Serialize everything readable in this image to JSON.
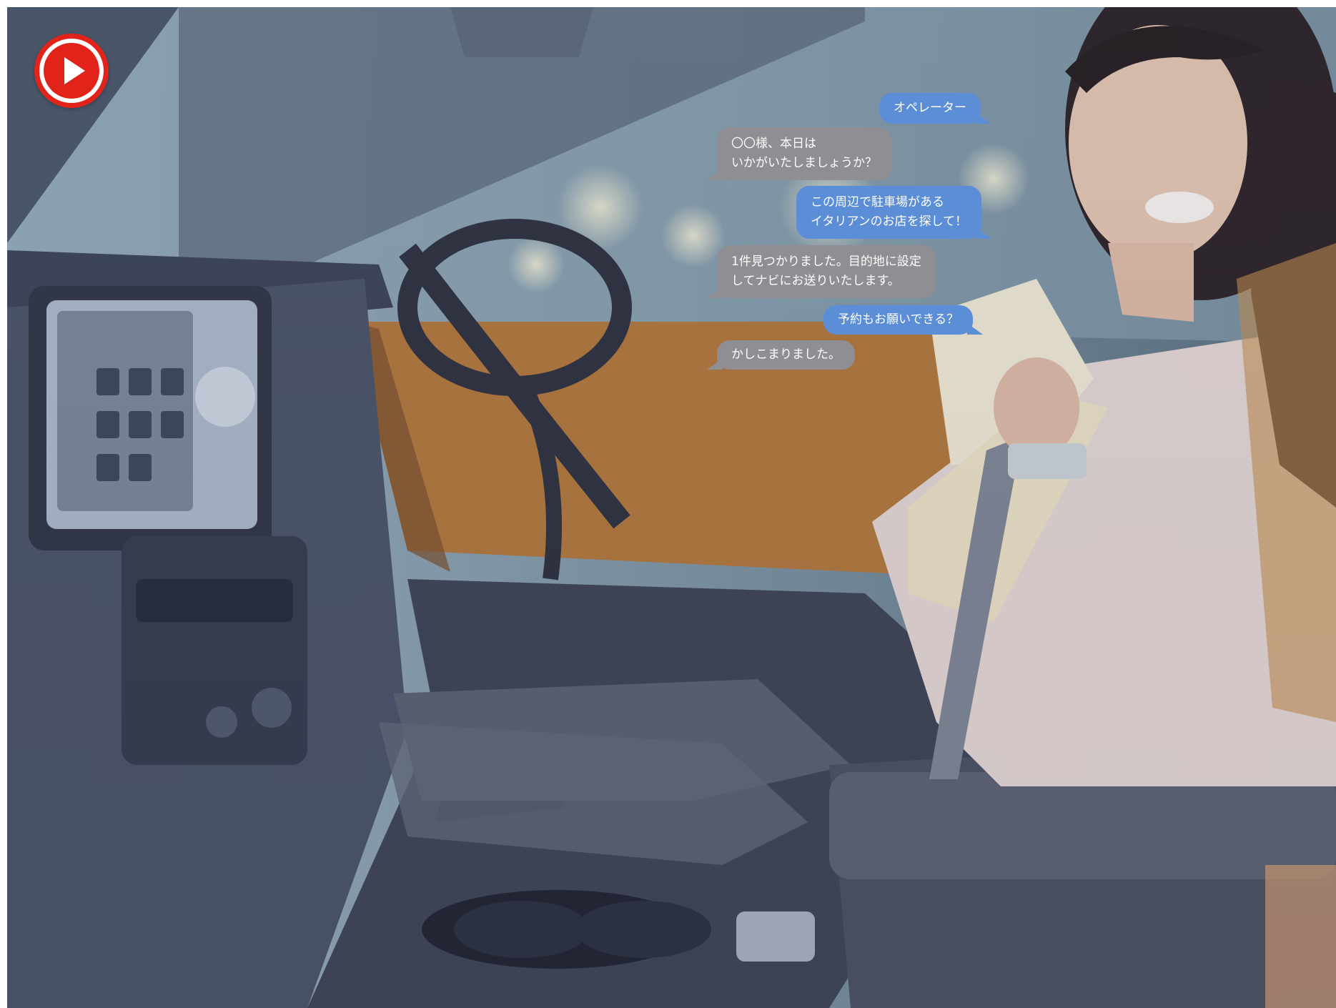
{
  "video": {
    "play_icon": "play-icon",
    "accent_color": "#e2231a"
  },
  "chat": {
    "operator_label": "オペレーター",
    "messages": [
      {
        "speaker": "operator",
        "text": "〇〇様、本日は\nいかがいたしましょうか？"
      },
      {
        "speaker": "user",
        "text": "この周辺で駐車場がある\nイタリアンのお店を探して！"
      },
      {
        "speaker": "operator",
        "text": "1件見つかりました。目的地に設定\nしてナビにお送りいたします。"
      },
      {
        "speaker": "user",
        "text": "予約もお願いできる？"
      },
      {
        "speaker": "operator",
        "text": "かしこまりました。"
      }
    ]
  },
  "colors": {
    "user_bubble": "#5b8ed6",
    "operator_bubble": "#8e8e93"
  }
}
